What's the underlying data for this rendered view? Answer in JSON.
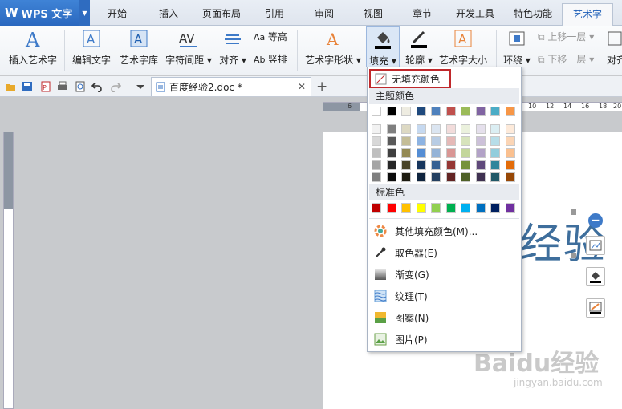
{
  "app": {
    "name": "WPS 文字"
  },
  "tabs": [
    "开始",
    "插入",
    "页面布局",
    "引用",
    "审阅",
    "视图",
    "章节",
    "开发工具",
    "特色功能",
    "艺术字"
  ],
  "ribbon": {
    "insert_art": "插入艺术字",
    "edit_text": "编辑文字",
    "art_library": "艺术字库",
    "char_spacing": "字符间距",
    "align": "对齐",
    "equal_height": "等高",
    "vertical": "竖排",
    "art_shape": "艺术字形状",
    "fill": "填充",
    "outline": "轮廓",
    "art_size": "艺术字大小",
    "wrap": "环绕",
    "move_up": "上移一层",
    "move_down": "下移一层",
    "align_right": "对齐"
  },
  "document": {
    "tab_title": "百度经验2.doc *",
    "art_text": "经验"
  },
  "ruler": {
    "h_ticks": [
      "6",
      "10",
      "12",
      "14",
      "16",
      "18",
      "20"
    ]
  },
  "dropdown": {
    "no_fill": "无填充颜色",
    "theme_colors_title": "主题颜色",
    "standard_colors_title": "标准色",
    "theme_top": [
      "#ffffff",
      "#000000",
      "#eeece1",
      "#1f497d",
      "#4f81bd",
      "#c0504d",
      "#9bbb59",
      "#8064a2",
      "#4bacc6",
      "#f79646"
    ],
    "theme_shades": [
      [
        "#f2f2f2",
        "#7f7f7f",
        "#ddd9c3",
        "#c6d9f0",
        "#dbe5f1",
        "#f2dcdb",
        "#ebf1dd",
        "#e5e0ec",
        "#dbeef3",
        "#fdeada"
      ],
      [
        "#d8d8d8",
        "#595959",
        "#c4bd97",
        "#8db3e2",
        "#b8cce4",
        "#e5b9b7",
        "#d7e3bc",
        "#ccc1d9",
        "#b7dde8",
        "#fbd5b5"
      ],
      [
        "#bfbfbf",
        "#3f3f3f",
        "#938953",
        "#548dd4",
        "#95b3d7",
        "#d99694",
        "#c3d69b",
        "#b2a2c7",
        "#92cddc",
        "#fac08f"
      ],
      [
        "#a5a5a5",
        "#262626",
        "#494429",
        "#17365d",
        "#366092",
        "#953734",
        "#76923c",
        "#5f497a",
        "#31859b",
        "#e36c09"
      ],
      [
        "#7f7f7f",
        "#0c0c0c",
        "#1d1b10",
        "#0f243e",
        "#244061",
        "#632423",
        "#4f6128",
        "#3f3151",
        "#205867",
        "#974806"
      ]
    ],
    "standard": [
      "#c00000",
      "#ff0000",
      "#ffc000",
      "#ffff00",
      "#92d050",
      "#00b050",
      "#00b0f0",
      "#0070c0",
      "#002060",
      "#7030a0"
    ],
    "items": [
      "其他填充颜色(M)...",
      "取色器(E)",
      "渐变(G)",
      "纹理(T)",
      "图案(N)",
      "图片(P)"
    ]
  },
  "watermark": {
    "brand": "Baidu经验",
    "url": "jingyan.baidu.com"
  }
}
